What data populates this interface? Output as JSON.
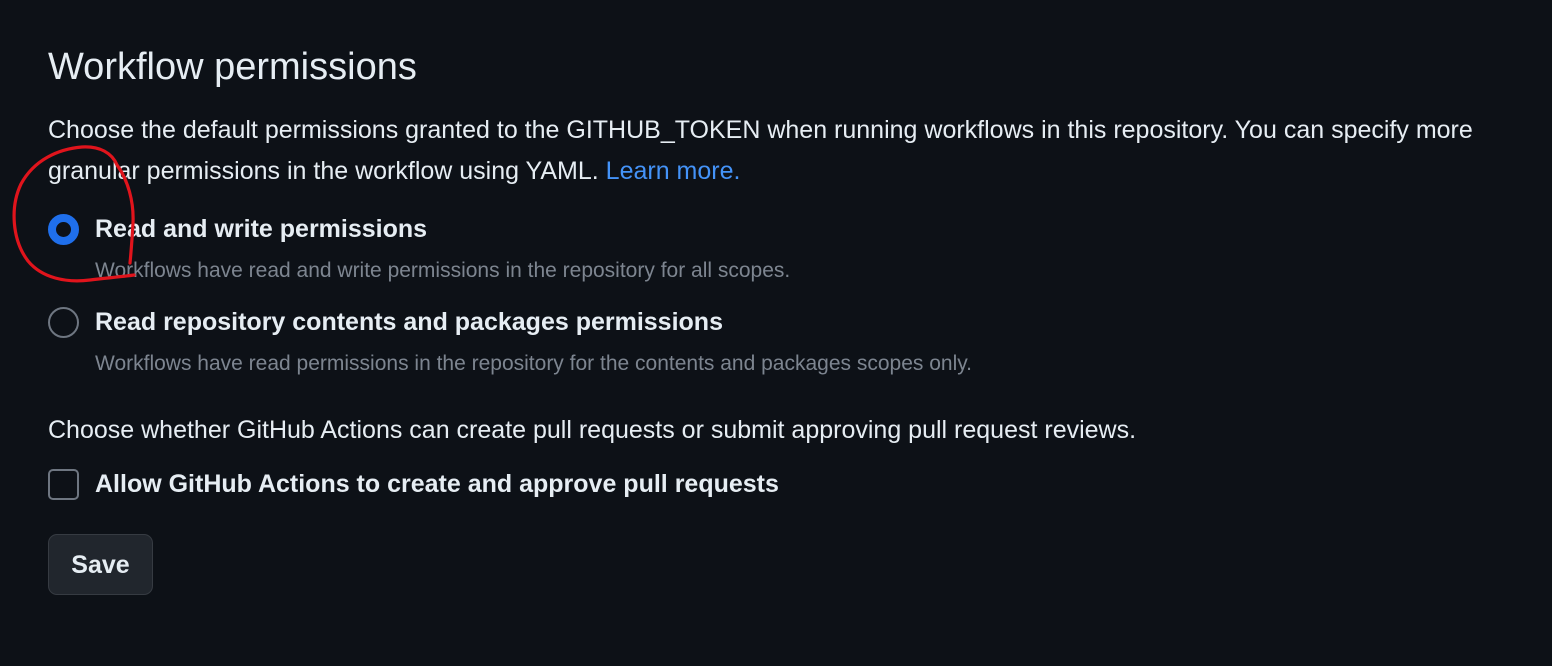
{
  "section": {
    "title": "Workflow permissions",
    "description": "Choose the default permissions granted to the GITHUB_TOKEN when running workflows in this repository. You can specify more granular permissions in the workflow using YAML.",
    "learn_more_label": "Learn more."
  },
  "permission_options": [
    {
      "label": "Read and write permissions",
      "note": "Workflows have read and write permissions in the repository for all scopes.",
      "selected": true
    },
    {
      "label": "Read repository contents and packages permissions",
      "note": "Workflows have read permissions in the repository for the contents and packages scopes only.",
      "selected": false
    }
  ],
  "pull_requests": {
    "question": "Choose whether GitHub Actions can create pull requests or submit approving pull request reviews.",
    "checkbox_label": "Allow GitHub Actions to create and approve pull requests",
    "checked": false
  },
  "actions": {
    "save_label": "Save"
  },
  "colors": {
    "background": "#0d1117",
    "text": "#e6edf3",
    "muted_text": "#7d8590",
    "link": "#4493f8",
    "radio_selected": "#1f6feb",
    "button_bg": "#21262d",
    "annotation_stroke": "#e0141c"
  },
  "annotation": {
    "shape": "hand-drawn circle",
    "target": "read-write-radio"
  }
}
